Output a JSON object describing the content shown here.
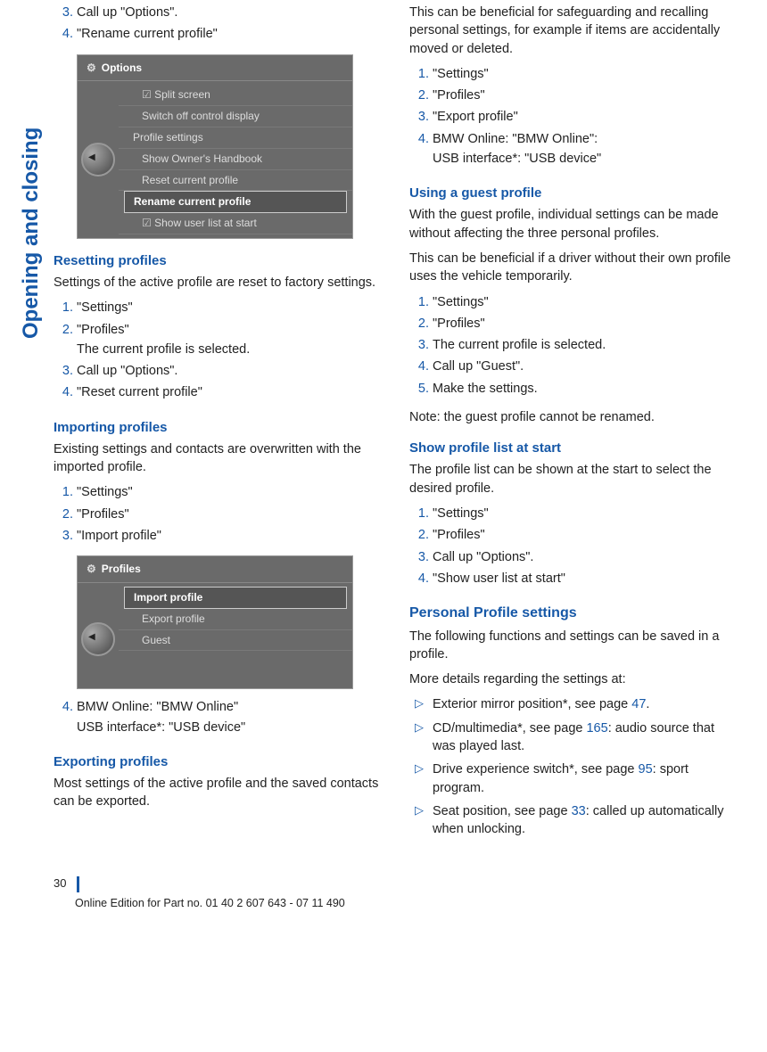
{
  "sideLabel": "Opening and closing",
  "pageNumber": "30",
  "footerText": "Online Edition for Part no. 01 40 2 607 643 - 07 11 490",
  "left": {
    "topList": {
      "item3": "Call up \"Options\".",
      "item4": "\"Rename current profile\""
    },
    "screenshot1": {
      "title": "Options",
      "m1": "Split screen",
      "m2": "Switch off control display",
      "m3": "Profile settings",
      "m4": "Show Owner's Handbook",
      "m5": "Reset current profile",
      "m6": "Rename current profile",
      "m7": "Show user list at start"
    },
    "resetting": {
      "heading": "Resetting profiles",
      "intro": "Settings of the active profile are reset to factory settings.",
      "l1": "\"Settings\"",
      "l2": "\"Profiles\"",
      "l2sub": "The current profile is selected.",
      "l3": "Call up \"Options\".",
      "l4": "\"Reset current profile\""
    },
    "importing": {
      "heading": "Importing profiles",
      "intro": "Existing settings and contacts are overwritten with the imported profile.",
      "l1": "\"Settings\"",
      "l2": "\"Profiles\"",
      "l3": "\"Import profile\""
    },
    "screenshot2": {
      "title": "Profiles",
      "m1": "Import profile",
      "m2": "Export profile",
      "m3": "Guest"
    },
    "importing2": {
      "l4": "BMW Online: \"BMW Online\"",
      "l4sub": "USB interface*: \"USB device\""
    },
    "exporting": {
      "heading": "Exporting profiles",
      "intro": "Most settings of the active profile and the saved contacts can be exported."
    }
  },
  "right": {
    "exportCont": {
      "intro": "This can be beneficial for safeguarding and recalling personal settings, for example if items are accidentally moved or deleted.",
      "l1": "\"Settings\"",
      "l2": "\"Profiles\"",
      "l3": "\"Export profile\"",
      "l4": "BMW Online: \"BMW Online\":",
      "l4sub": "USB interface*: \"USB device\""
    },
    "guest": {
      "heading": "Using a guest profile",
      "p1": "With the guest profile, individual settings can be made without affecting the three personal profiles.",
      "p2": "This can be beneficial if a driver without their own profile uses the vehicle temporarily.",
      "l1": "\"Settings\"",
      "l2": "\"Profiles\"",
      "l3": "The current profile is selected.",
      "l4": "Call up \"Guest\".",
      "l5": "Make the settings.",
      "note": "Note: the guest profile cannot be renamed."
    },
    "showlist": {
      "heading": "Show profile list at start",
      "intro": "The profile list can be shown at the start to select the desired profile.",
      "l1": "\"Settings\"",
      "l2": "\"Profiles\"",
      "l3": "Call up \"Options\".",
      "l4": "\"Show user list at start\""
    },
    "personal": {
      "heading": "Personal Profile settings",
      "p1": "The following functions and settings can be saved in a profile.",
      "p2": "More details regarding the settings at:",
      "b1a": "Exterior mirror position*, see page ",
      "b1p": "47",
      "b1b": ".",
      "b2a": "CD/multimedia*, see page ",
      "b2p": "165",
      "b2b": ": audio source that was played last.",
      "b3a": "Drive experience switch*, see page ",
      "b3p": "95",
      "b3b": ": sport program.",
      "b4a": "Seat position, see page ",
      "b4p": "33",
      "b4b": ": called up automatically when unlocking."
    }
  }
}
